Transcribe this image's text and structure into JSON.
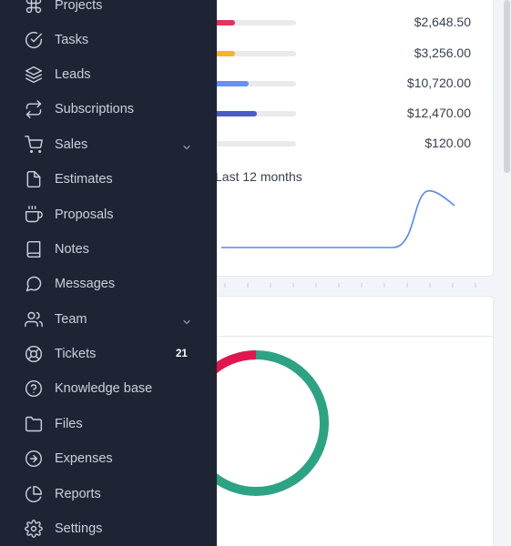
{
  "invoices": {
    "rows": [
      {
        "amount": "$2,648.50",
        "color": "#e5325e",
        "progress_pct": 8
      },
      {
        "amount": "$3,256.00",
        "color": "#f5b32a",
        "progress_pct": 8
      },
      {
        "amount": "$10,720.00",
        "color": "#6c8ef5",
        "progress_pct": 20
      },
      {
        "amount": "$12,470.00",
        "color": "#4c5bc4",
        "progress_pct": 27
      },
      {
        "amount": "$120.00",
        "color": "#c8ccd4",
        "progress_pct": 0
      }
    ]
  },
  "chart": {
    "caption": "Last 12 months",
    "line_color": "#5b87e8"
  },
  "donut": {
    "colors": [
      "#2ea383",
      "#e1164e"
    ],
    "segments": [
      0.9,
      0.1
    ]
  },
  "sidebar": {
    "background": "#1e2433",
    "items": [
      {
        "label": "Projects",
        "icon": "command-icon"
      },
      {
        "label": "Tasks",
        "icon": "check-circle-icon"
      },
      {
        "label": "Leads",
        "icon": "layers-icon"
      },
      {
        "label": "Subscriptions",
        "icon": "repeat-icon"
      },
      {
        "label": "Sales",
        "icon": "cart-icon"
      },
      {
        "label": "Estimates",
        "icon": "file-icon"
      },
      {
        "label": "Proposals",
        "icon": "coffee-icon"
      },
      {
        "label": "Notes",
        "icon": "book-icon"
      },
      {
        "label": "Messages",
        "icon": "message-circle-icon"
      },
      {
        "label": "Team",
        "icon": "users-icon"
      },
      {
        "label": "Tickets",
        "icon": "life-buoy-icon",
        "badge": "21"
      },
      {
        "label": "Knowledge base",
        "icon": "help-circle-icon"
      },
      {
        "label": "Files",
        "icon": "folder-icon"
      },
      {
        "label": "Expenses",
        "icon": "arrow-right-circle-icon"
      },
      {
        "label": "Reports",
        "icon": "pie-chart-icon"
      },
      {
        "label": "Settings",
        "icon": "gear-icon"
      }
    ]
  }
}
